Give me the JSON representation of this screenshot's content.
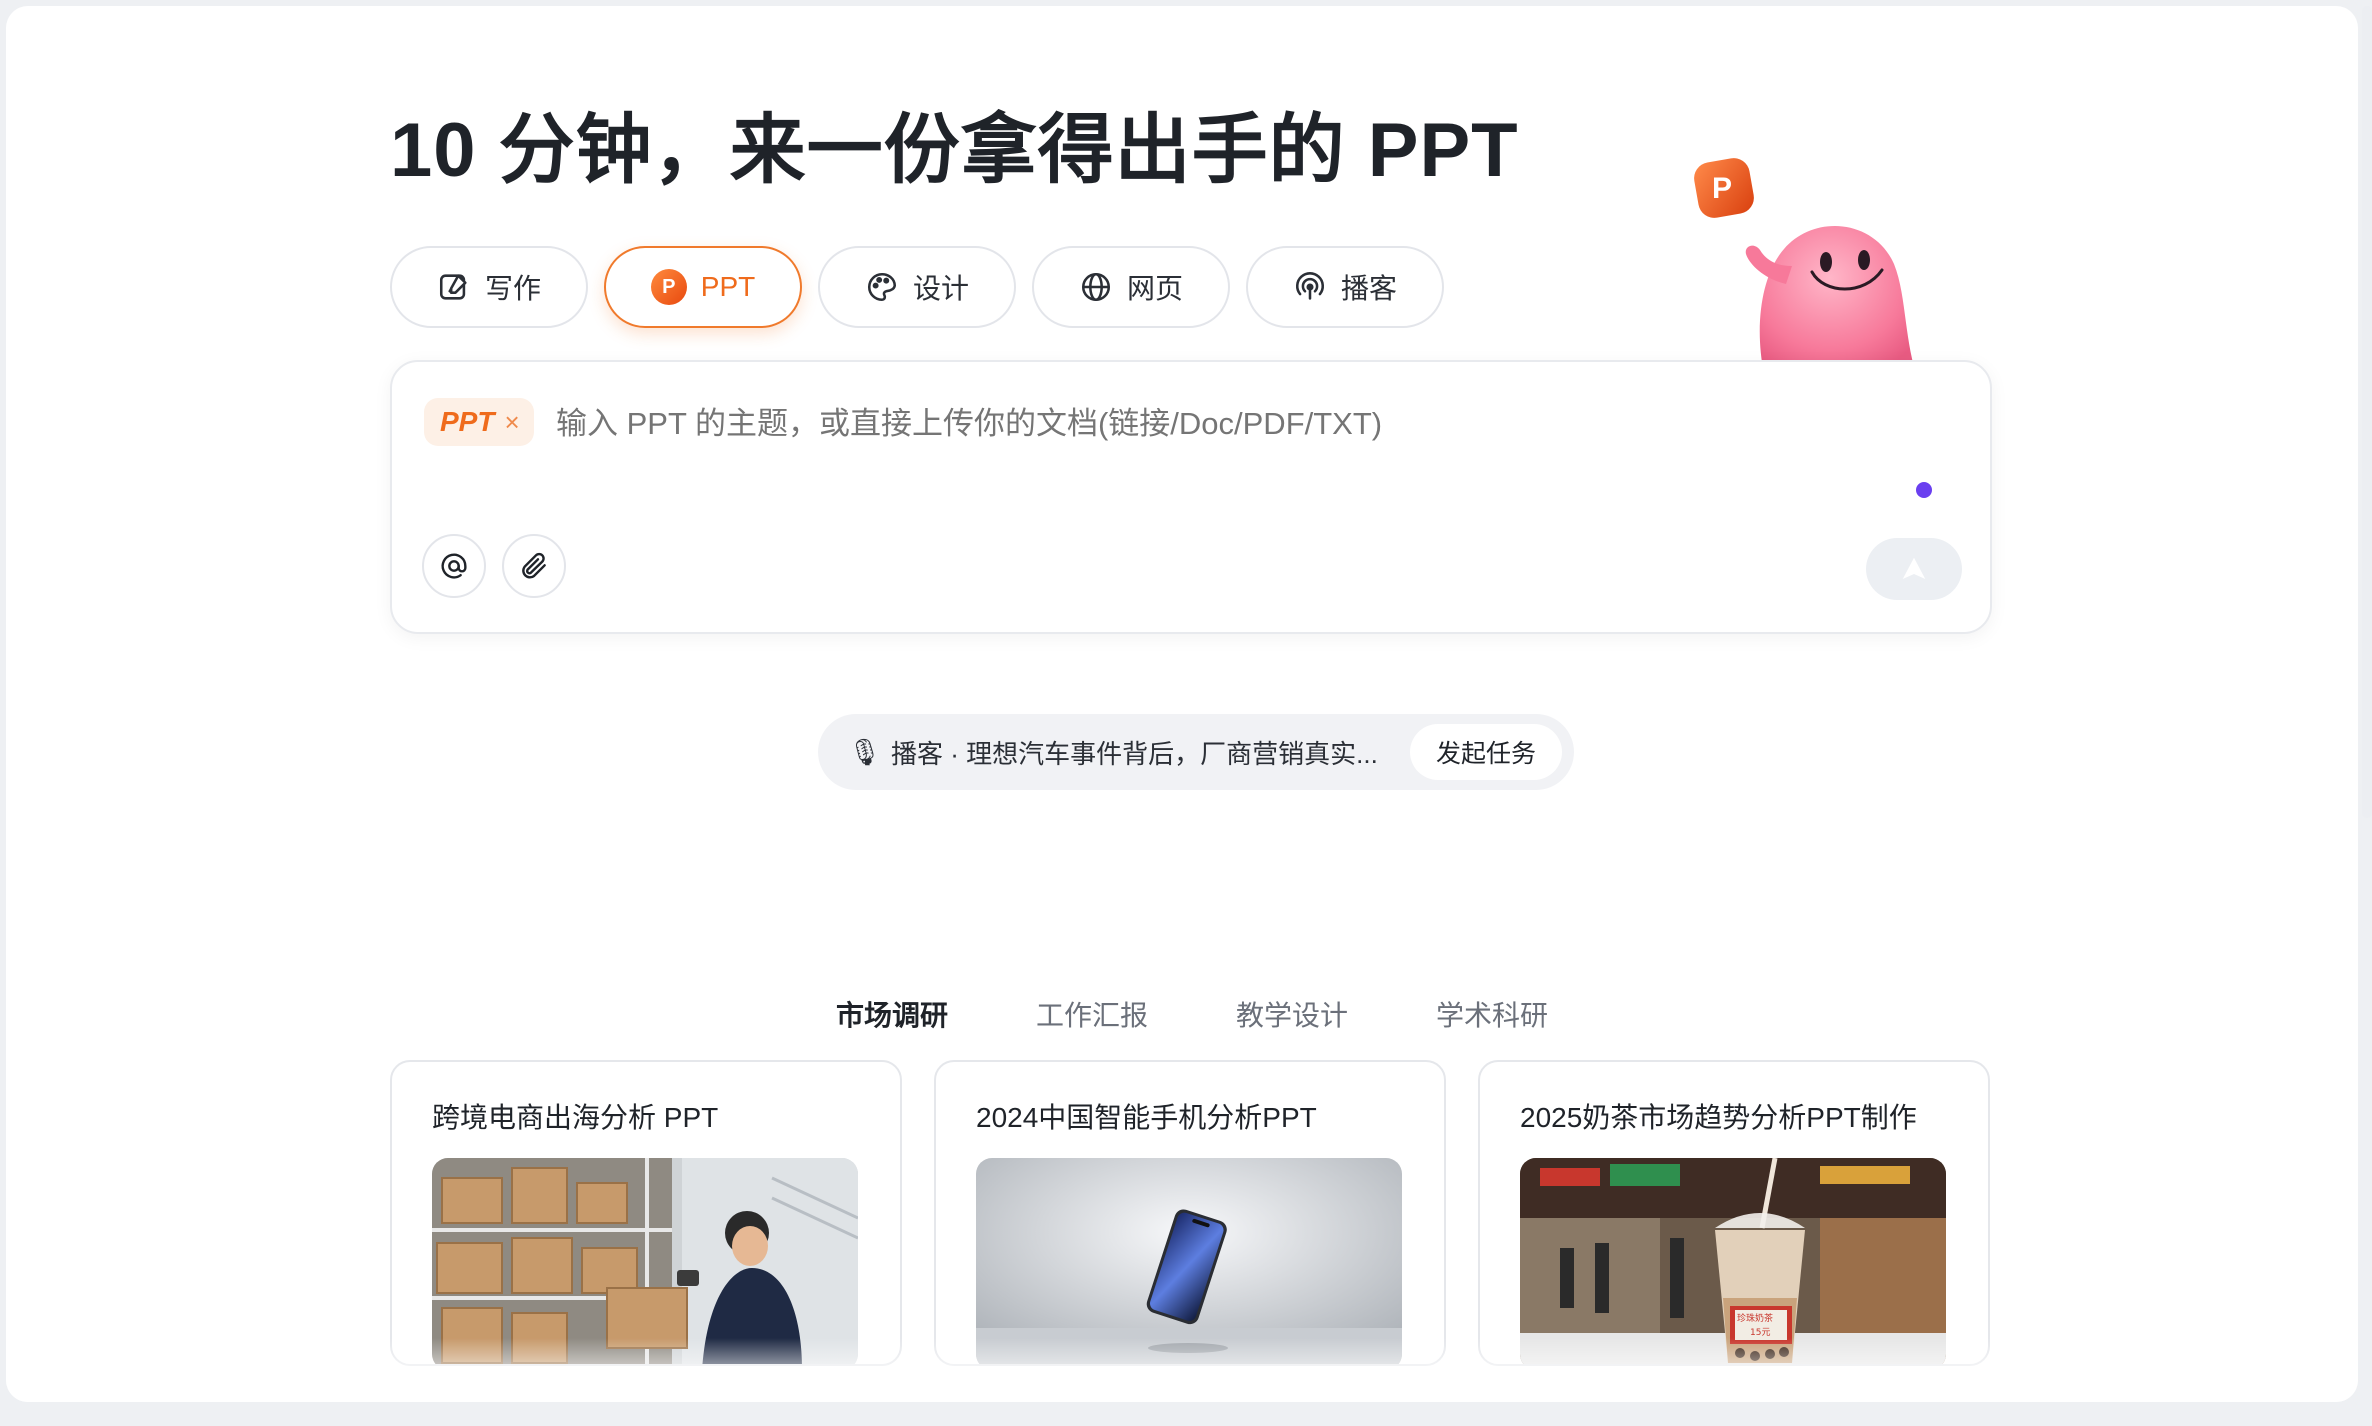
{
  "headline": "10 分钟，来一份拿得出手的 PPT",
  "tabs": [
    {
      "label": "写作",
      "icon": "writing-icon"
    },
    {
      "label": "PPT",
      "icon": "ppt-icon",
      "active": true
    },
    {
      "label": "设计",
      "icon": "palette-icon"
    },
    {
      "label": "网页",
      "icon": "globe-icon"
    },
    {
      "label": "播客",
      "icon": "podcast-icon"
    }
  ],
  "mascot": {
    "badge": "P"
  },
  "input": {
    "chip": "PPT",
    "chip_close": "×",
    "placeholder": "输入 PPT 的主题，或直接上传你的文档(链接/Doc/PDF/TXT)"
  },
  "suggestion": {
    "icon": "microphone-icon",
    "text": "播客 · 理想汽车事件背后，厂商营销真实...",
    "button": "发起任务"
  },
  "categories": [
    {
      "label": "市场调研",
      "active": true
    },
    {
      "label": "工作汇报"
    },
    {
      "label": "教学设计"
    },
    {
      "label": "学术科研"
    }
  ],
  "cards": [
    {
      "title": "跨境电商出海分析 PPT",
      "image": "warehouse-worker-scanning-boxes"
    },
    {
      "title": "2024中国智能手机分析PPT",
      "image": "floating-smartphone"
    },
    {
      "title": "2025奶茶市场趋势分析PPT制作",
      "image": "bubble-tea-street-stall",
      "cup_label": "珍珠奶茶 15元"
    }
  ],
  "colors": {
    "accent": "#ef6b1c",
    "dot": "#6a3ff0",
    "text": "#1f2329"
  }
}
